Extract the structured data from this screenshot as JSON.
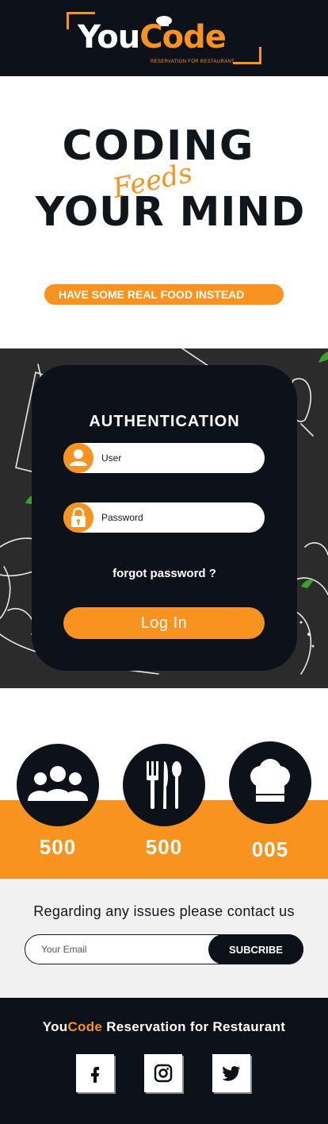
{
  "header": {
    "logo": {
      "part1": "You",
      "part2": "Code",
      "tagline": "RESERVATION FOR RESTAURANT"
    }
  },
  "hero": {
    "line1": "CODING",
    "script": "Feeds",
    "line2": "YOUR MIND",
    "pill": "HAVE SOME REAL FOOD INSTEAD"
  },
  "auth": {
    "title": "AUTHENTICATION",
    "user_placeholder": "User",
    "password_placeholder": "Password",
    "forgot": "forgot password ?",
    "login": "Log In"
  },
  "stats": [
    {
      "icon": "users-icon",
      "value": "500"
    },
    {
      "icon": "cutlery-icon",
      "value": "500"
    },
    {
      "icon": "chef-hat-icon",
      "value": "005"
    }
  ],
  "newsletter": {
    "heading": "Regarding any issues please contact us",
    "email_placeholder": "Your Email",
    "button": "SUBCRIBE"
  },
  "footer": {
    "brand_part1": "You",
    "brand_part2": "Code",
    "brand_rest": " Reservation for Restaurant",
    "social": [
      "facebook-icon",
      "instagram-icon",
      "twitter-icon"
    ]
  },
  "colors": {
    "accent": "#f7931e",
    "dark": "#0d111a",
    "panel": "#2b2b2b"
  }
}
